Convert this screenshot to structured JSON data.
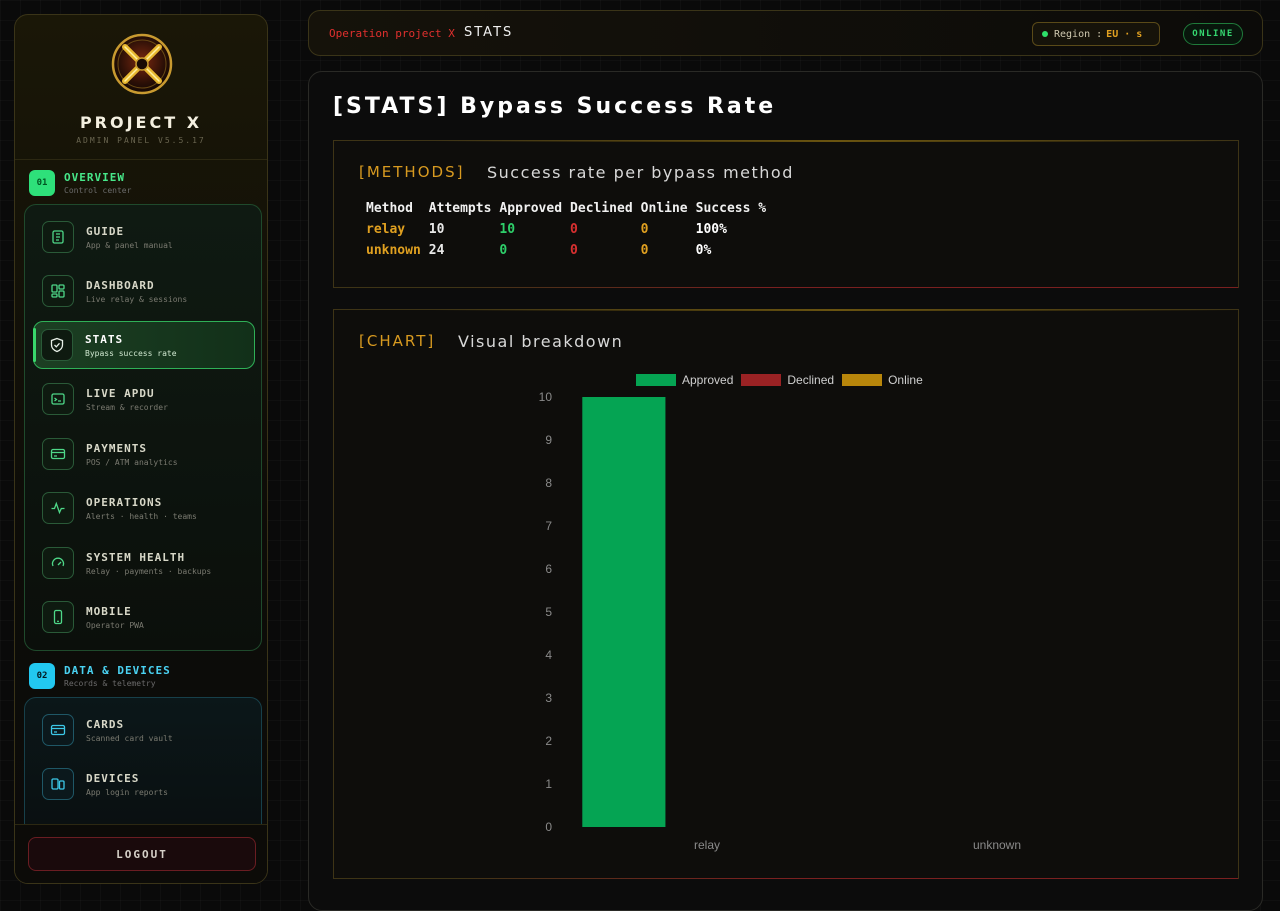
{
  "brand": {
    "name": "PROJECT X",
    "sub": "ADMIN PANEL V5.5.17"
  },
  "sections": [
    {
      "badge": "01",
      "title": "OVERVIEW",
      "sub": "Control center",
      "color": "#2ee07a"
    },
    {
      "badge": "02",
      "title": "DATA & DEVICES",
      "sub": "Records & telemetry",
      "color": "#22c8f0"
    }
  ],
  "nav_overview": [
    {
      "icon": "book-icon",
      "label": "GUIDE",
      "sub": "App & panel manual"
    },
    {
      "icon": "dashboard-icon",
      "label": "DASHBOARD",
      "sub": "Live relay & sessions"
    },
    {
      "icon": "shield-icon",
      "label": "STATS",
      "sub": "Bypass success rate",
      "active": true
    },
    {
      "icon": "terminal-icon",
      "label": "LIVE APDU",
      "sub": "Stream & recorder"
    },
    {
      "icon": "payment-card-icon",
      "label": "PAYMENTS",
      "sub": "POS / ATM analytics"
    },
    {
      "icon": "pulse-icon",
      "label": "OPERATIONS",
      "sub": "Alerts · health · teams"
    },
    {
      "icon": "gauge-icon",
      "label": "SYSTEM HEALTH",
      "sub": "Relay · payments · backups"
    },
    {
      "icon": "phone-icon",
      "label": "MOBILE",
      "sub": "Operator PWA"
    }
  ],
  "nav_data": [
    {
      "icon": "card-icon",
      "label": "CARDS",
      "sub": "Scanned card vault"
    },
    {
      "icon": "devices-icon",
      "label": "DEVICES",
      "sub": "App login reports"
    }
  ],
  "logout_label": "LOGOUT",
  "header": {
    "crumb": "Operation project X",
    "page": "STATS",
    "region_label": "Region :",
    "region_value": "EU · s",
    "status": "ONLINE"
  },
  "page_title": "[STATS] Bypass Success Rate",
  "methods_panel": {
    "tag": "[METHODS]",
    "title": "Success rate per bypass method",
    "columns": [
      "Method",
      "Attempts",
      "Approved",
      "Declined",
      "Online",
      "Success %"
    ],
    "rows": [
      {
        "method": "relay",
        "attempts": "10",
        "approved": "10",
        "declined": "0",
        "online": "0",
        "success": "100%"
      },
      {
        "method": "unknown",
        "attempts": "24",
        "approved": "0",
        "declined": "0",
        "online": "0",
        "success": "0%"
      }
    ]
  },
  "chart_panel": {
    "tag": "[CHART]",
    "title": "Visual breakdown"
  },
  "chart_data": {
    "type": "bar",
    "categories": [
      "relay",
      "unknown"
    ],
    "series": [
      {
        "name": "Approved",
        "values": [
          10,
          0
        ],
        "color": "#05a453"
      },
      {
        "name": "Declined",
        "values": [
          0,
          0
        ],
        "color": "#9a2224"
      },
      {
        "name": "Online",
        "values": [
          0,
          0
        ],
        "color": "#b8860b"
      }
    ],
    "ylim": [
      0,
      10
    ],
    "yticks": [
      "0",
      "1",
      "2",
      "3",
      "4",
      "5",
      "6",
      "7",
      "8",
      "9",
      "10"
    ],
    "legend_position": "top-center",
    "grid": false
  },
  "colors": {
    "accent": "#e0a020",
    "danger": "#d83030",
    "success": "#2ecf6a"
  }
}
